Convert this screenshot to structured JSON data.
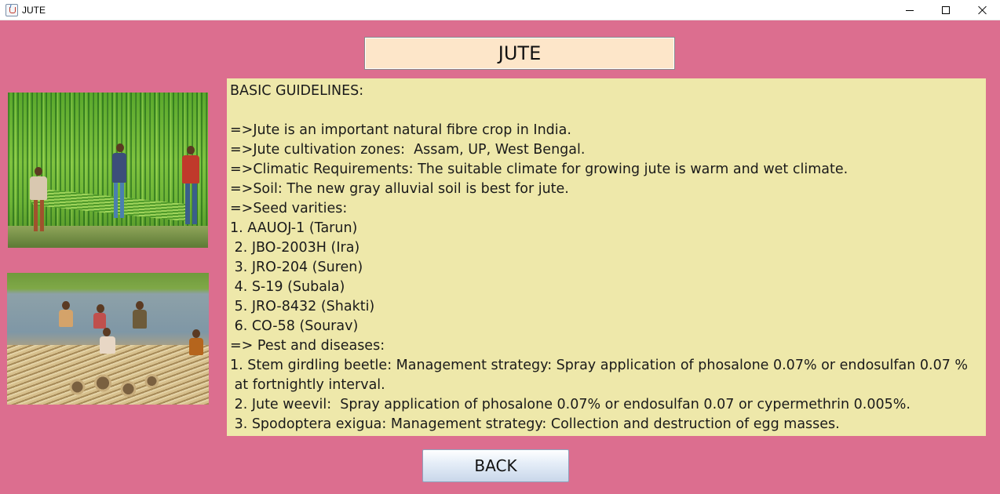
{
  "window": {
    "title": "JUTE",
    "controls": {
      "minimize": "minimize-icon",
      "maximize": "maximize-icon",
      "close": "close-icon"
    }
  },
  "heading": "JUTE",
  "images": [
    {
      "name": "jute-field-harvest-photo",
      "description_icon": "photo"
    },
    {
      "name": "jute-retting-water-photo",
      "description_icon": "photo"
    }
  ],
  "guidelines": {
    "lines": [
      "BASIC GUIDELINES:",
      "",
      "=>Jute is an important natural fibre crop in India.",
      "=>Jute cultivation zones:  Assam, UP, West Bengal.",
      "=>Climatic Requirements: The suitable climate for growing jute is warm and wet climate.",
      "=>Soil: The new gray alluvial soil is best for jute.",
      "=>Seed varities:",
      "1. AAUOJ-1 (Tarun)",
      " 2. JBO-2003H (Ira)",
      " 3. JRO-204 (Suren)",
      " 4. S-19 (Subala)",
      " 5. JRO-8432 (Shakti)",
      " 6. CO-58 (Sourav)",
      "=> Pest and diseases:",
      "1. Stem girdling beetle: Management strategy: Spray application of phosalone 0.07% or endosulfan 0.07 %",
      " at fortnightly interval.",
      " 2. Jute weevil:  Spray application of phosalone 0.07% or endosulfan 0.07 or cypermethrin 0.005%.",
      " 3. Spodoptera exigua: Management strategy: Collection and destruction of egg masses."
    ]
  },
  "back_button": {
    "label": "BACK"
  },
  "colors": {
    "background": "#dc6e8f",
    "heading_bg": "#fde6c9",
    "text_area_bg": "#eee8aa"
  }
}
